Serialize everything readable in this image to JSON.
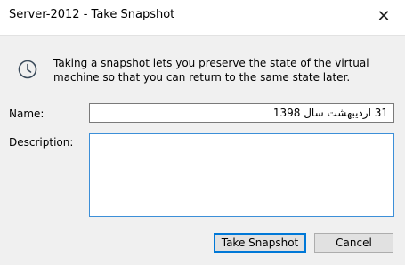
{
  "window": {
    "title": "Server-2012 - Take Snapshot",
    "close_icon": "close-icon"
  },
  "info": {
    "icon": "clock-icon",
    "text": "Taking a snapshot lets you preserve the state of the virtual machine so that you can return to the same state later."
  },
  "form": {
    "name_label": "Name:",
    "name_value": "31 اردیبهشت سال 1398",
    "description_label": "Description:",
    "description_value": ""
  },
  "buttons": {
    "take_snapshot": "Take Snapshot",
    "cancel": "Cancel"
  },
  "colors": {
    "focus_border": "#0078d7",
    "dialog_bg": "#f0f0f0"
  }
}
